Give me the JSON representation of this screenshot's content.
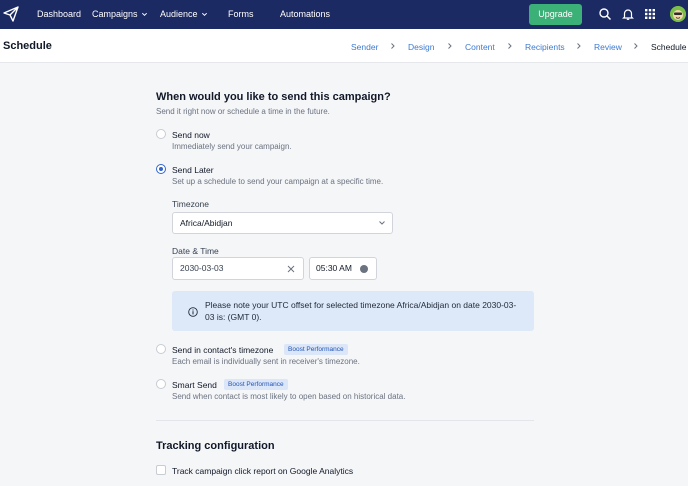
{
  "nav": {
    "items": [
      "Dashboard",
      "Campaigns",
      "Audience",
      "Forms",
      "Automations"
    ],
    "upgrade_label": "Upgrade",
    "icons": [
      "send-logo",
      "search-icon",
      "bell-icon",
      "apps-grid-icon",
      "avatar"
    ]
  },
  "header": {
    "title": "Schedule",
    "breadcrumbs": [
      "Sender",
      "Design",
      "Content",
      "Recipients",
      "Review",
      "Schedule"
    ]
  },
  "schedule": {
    "heading": "When would you like to send this campaign?",
    "subheading": "Send it right now or schedule a time in the future.",
    "options": [
      {
        "title": "Send now",
        "desc": "Immediately send your campaign.",
        "checked": false
      },
      {
        "title": "Send Later",
        "desc": "Set up a schedule to send your campaign at a specific time.",
        "checked": true
      },
      {
        "title": "Send in contact's timezone",
        "desc": "Each email is individually sent in receiver's timezone.",
        "badge": "Boost Performance",
        "checked": false
      },
      {
        "title": "Smart Send",
        "desc": "Send when contact is most likely to open based on historical data.",
        "badge": "Boost Performance",
        "checked": false
      }
    ],
    "timezone_label": "Timezone",
    "timezone_value": "Africa/Abidjan",
    "datetime_label": "Date & Time",
    "date_value": "2030-03-03",
    "time_value": "05:30 AM",
    "note": "Please note your UTC offset for selected timezone Africa/Abidjan on date 2030-03-03 is: (GMT 0)."
  },
  "tracking": {
    "heading": "Tracking configuration",
    "checkbox_label": "Track campaign click report on Google Analytics"
  },
  "colors": {
    "nav_bg": "#1c2a63",
    "upgrade": "#3bb077",
    "accent": "#3366cc",
    "link": "#3e7ad0",
    "note_bg": "#dde8f8"
  }
}
